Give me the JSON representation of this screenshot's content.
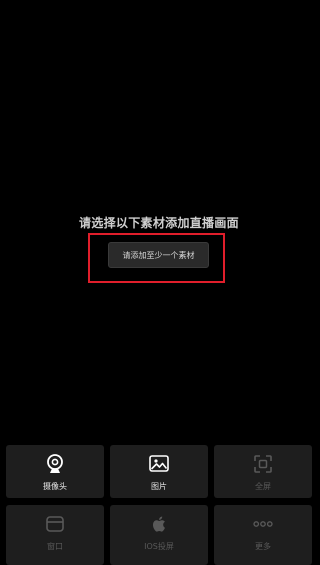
{
  "empty_state": {
    "prompt": "请选择以下素材添加直播画面",
    "add_button": "请添加至少一个素材"
  },
  "sources": [
    {
      "label": "摄像头",
      "icon": "webcam-icon",
      "enabled": true
    },
    {
      "label": "图片",
      "icon": "image-icon",
      "enabled": true
    },
    {
      "label": "全屏",
      "icon": "fullscreen-icon",
      "enabled": false
    },
    {
      "label": "窗口",
      "icon": "window-icon",
      "enabled": false
    },
    {
      "label": "IOS投屏",
      "icon": "apple-icon",
      "enabled": false
    },
    {
      "label": "更多",
      "icon": "more-icon",
      "enabled": false
    }
  ],
  "colors": {
    "background": "#000000",
    "tile": "#1e1e1e",
    "highlight": "#e01e2b",
    "enabled_text": "#e6e6e6",
    "disabled_text": "#595959"
  }
}
